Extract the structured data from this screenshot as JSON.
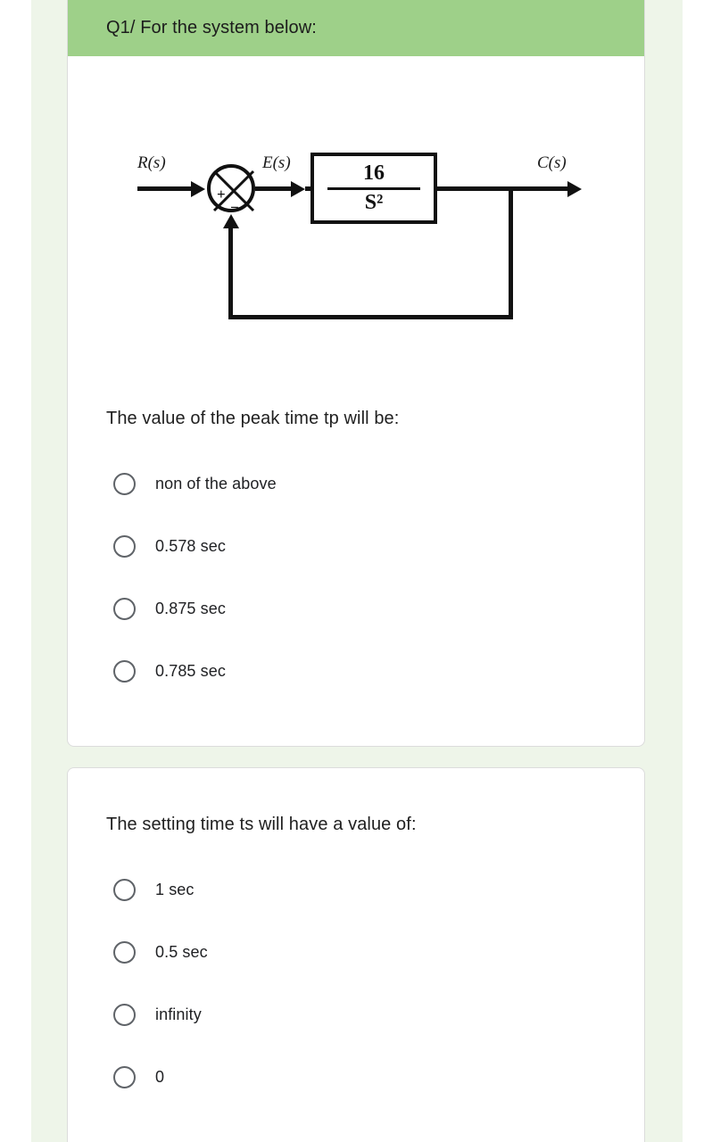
{
  "page": {
    "background_color": "#ffffff",
    "backdrop_color": "#eef5e9",
    "header_color": "#9ed089"
  },
  "header": {
    "title": "Q1/ For the system below:"
  },
  "diagram": {
    "name": "closed-loop-control-block-diagram",
    "input_label": "R(s)",
    "error_label": "E(s)",
    "output_label": "C(s)",
    "summing_junction": {
      "positive_sign": "+",
      "negative_sign": "−"
    },
    "transfer_function": {
      "numerator": "16",
      "denominator": "S²"
    },
    "feedback": "unity"
  },
  "questions": [
    {
      "id": "q-peak-time",
      "text": "The value of the peak time tp will be:",
      "options": [
        {
          "id": "opt-none-of-the-above",
          "label": "non of the above",
          "selected": false
        },
        {
          "id": "opt-0578",
          "label": "0.578 sec",
          "selected": false
        },
        {
          "id": "opt-0875",
          "label": "0.875 sec",
          "selected": false
        },
        {
          "id": "opt-0785",
          "label": "0.785 sec",
          "selected": false
        }
      ]
    },
    {
      "id": "q-settling-time",
      "text": "The setting time ts will have a value of:",
      "options": [
        {
          "id": "opt-1-sec",
          "label": "1 sec",
          "selected": false
        },
        {
          "id": "opt-05-sec",
          "label": "0.5 sec",
          "selected": false
        },
        {
          "id": "opt-infinity",
          "label": "infinity",
          "selected": false
        },
        {
          "id": "opt-zero",
          "label": "0",
          "selected": false
        }
      ]
    }
  ]
}
